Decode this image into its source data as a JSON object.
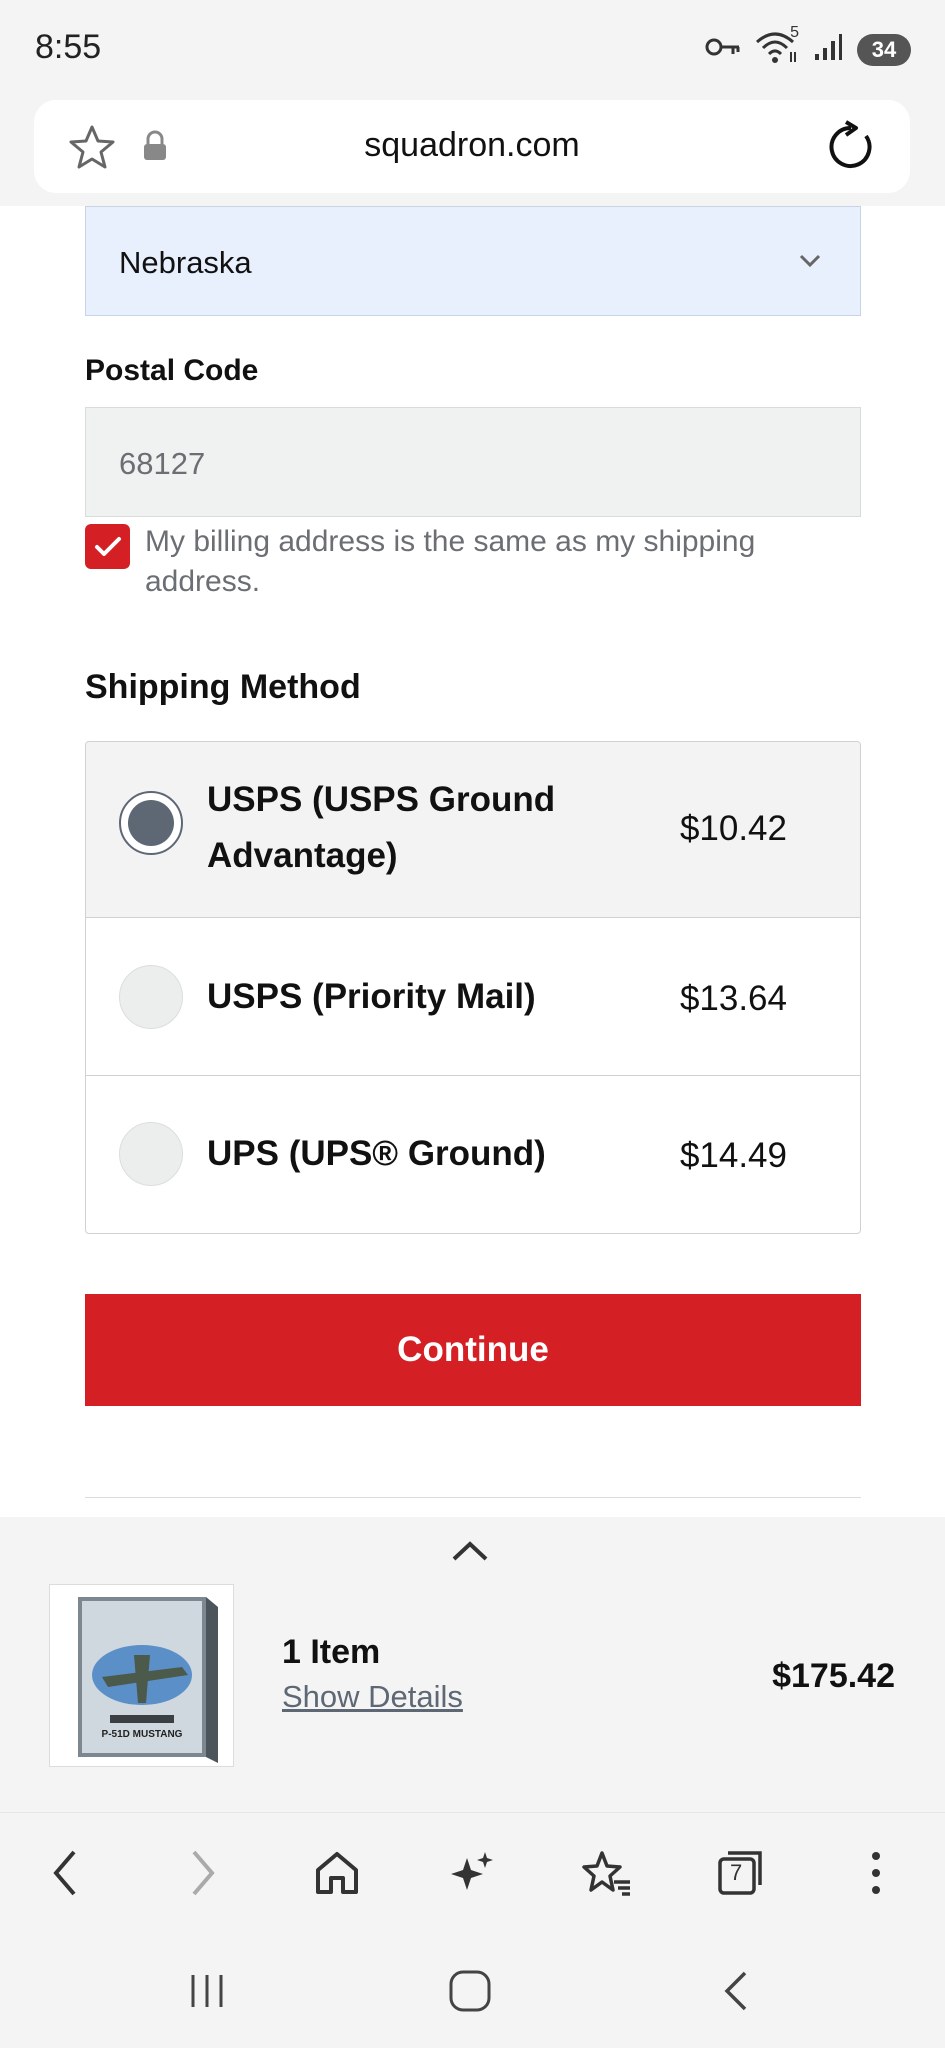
{
  "status_bar": {
    "time": "8:55",
    "wifi_badge": "5",
    "battery": "34"
  },
  "url_bar": {
    "url": "squadron.com"
  },
  "form": {
    "state_value": "Nebraska",
    "postal_label": "Postal Code",
    "postal_value": "68127",
    "billing_same_label": "My billing address is the same as my shipping address.",
    "billing_same_checked": true
  },
  "shipping": {
    "title": "Shipping Method",
    "options": [
      {
        "name": "USPS (USPS Ground Advantage)",
        "price": "$10.42",
        "selected": true
      },
      {
        "name": "USPS (Priority Mail)",
        "price": "$13.64",
        "selected": false
      },
      {
        "name": "UPS (UPS® Ground)",
        "price": "$14.49",
        "selected": false
      }
    ]
  },
  "continue_label": "Continue",
  "summary": {
    "items": "1 Item",
    "show_details": "Show Details",
    "total": "$175.42",
    "product_box_text": "P-51D MUSTANG"
  },
  "toolbar": {
    "tabs_count": "7"
  },
  "colors": {
    "accent": "#d42025",
    "autofill": "#e8f0fe",
    "radio": "#5e6874"
  }
}
